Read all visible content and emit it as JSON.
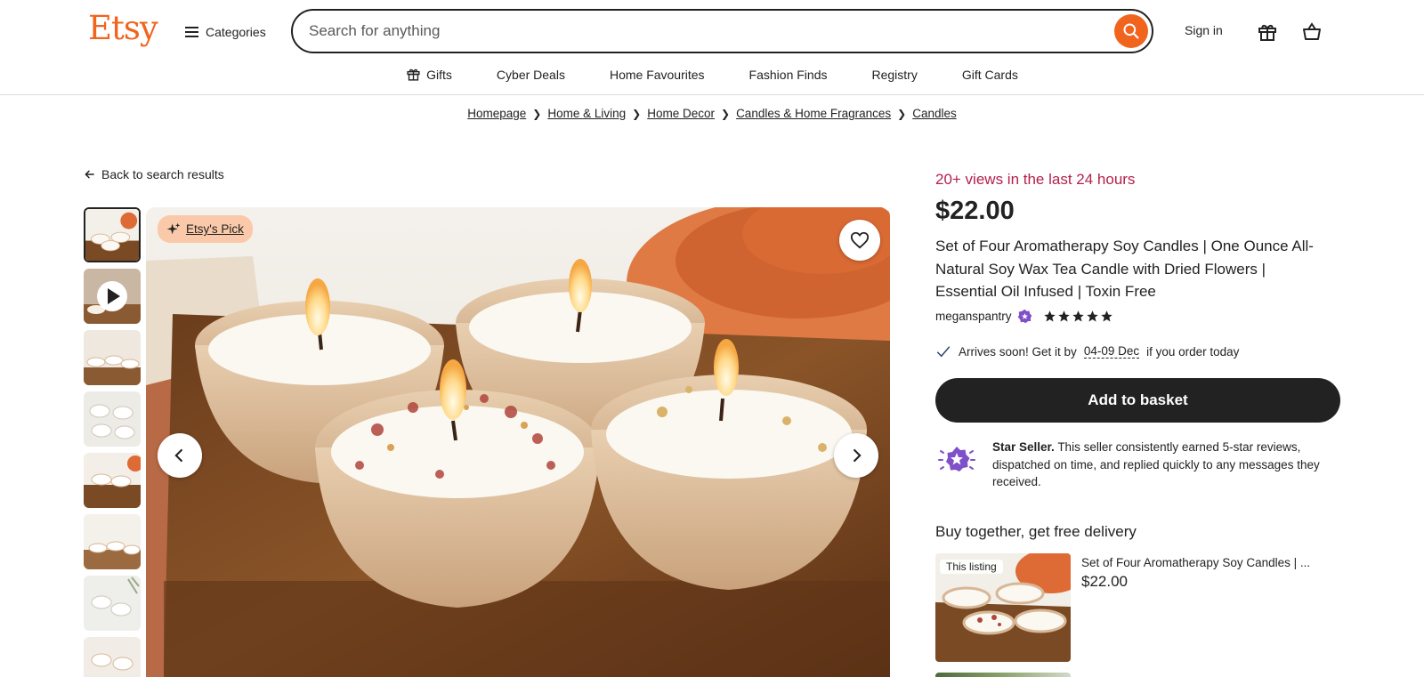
{
  "header": {
    "logo": "Etsy",
    "categories_label": "Categories",
    "search_placeholder": "Search for anything",
    "signin_label": "Sign in"
  },
  "nav": {
    "items": [
      "Gifts",
      "Cyber Deals",
      "Home Favourites",
      "Fashion Finds",
      "Registry",
      "Gift Cards"
    ]
  },
  "breadcrumb": [
    "Homepage",
    "Home & Living",
    "Home Decor",
    "Candles & Home Fragrances",
    "Candles"
  ],
  "back_link": "Back to search results",
  "gallery": {
    "badge": "Etsy's Pick",
    "thumbnail_count": 8
  },
  "listing": {
    "views": "20+ views in the last 24 hours",
    "price": "$22.00",
    "title": "Set of Four Aromatherapy Soy Candles | One Ounce All-Natural Soy Wax Tea Candle with Dried Flowers | Essential Oil Infused | Toxin Free",
    "shop_name": "meganspantry",
    "rating_stars": 5,
    "arrives_prefix": "Arrives soon! Get it by",
    "arrives_date": "04-09 Dec",
    "arrives_suffix": "if you order today",
    "add_to_basket": "Add to basket",
    "star_seller_title": "Star Seller.",
    "star_seller_text": "This seller consistently earned 5-star reviews, dispatched on time, and replied quickly to any messages they received."
  },
  "buy_together": {
    "heading": "Buy together, get free delivery",
    "label": "This listing",
    "item_title": "Set of Four Aromatherapy Soy Candles | ...",
    "item_price": "$22.00"
  },
  "colors": {
    "brand_orange": "#F1641E",
    "views_red": "#B3204D",
    "dark": "#222222",
    "star_seller_purple": "#7F50C9",
    "badge_peach": "#FAC9A9"
  }
}
